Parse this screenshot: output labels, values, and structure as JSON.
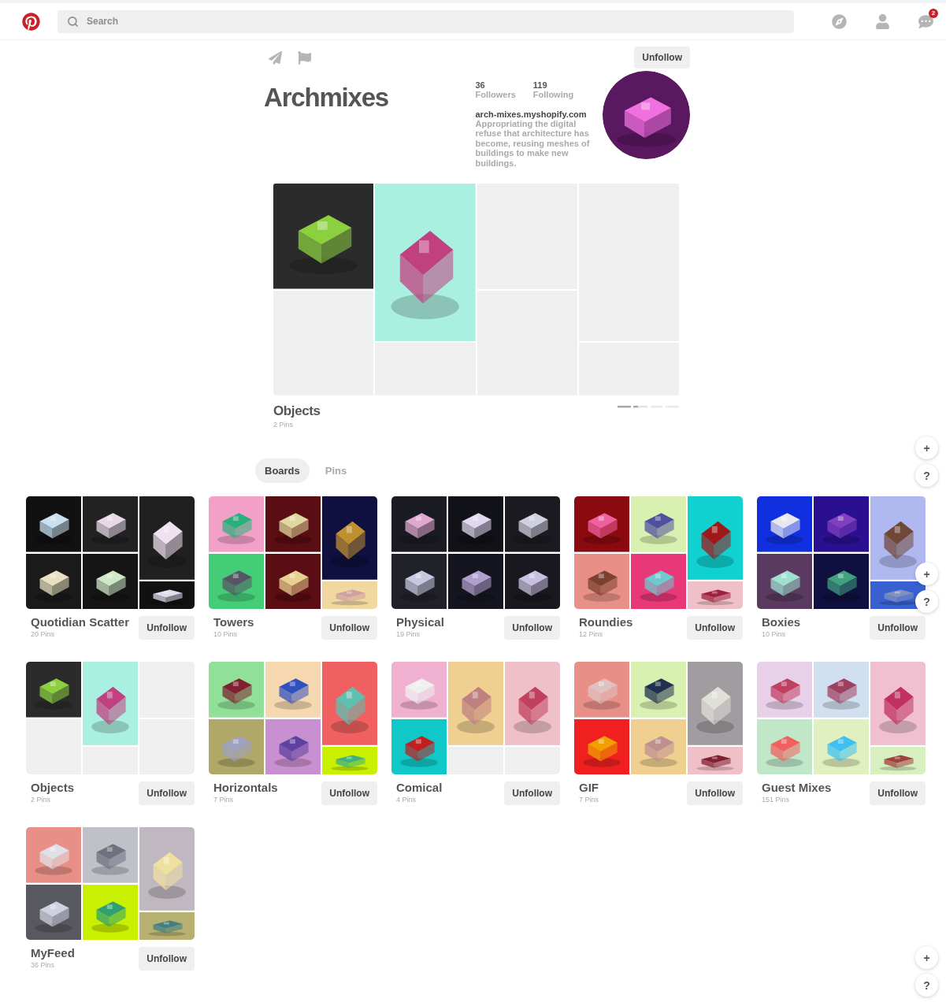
{
  "header": {
    "search": {
      "placeholder": "Search"
    },
    "notifications_badge": "2"
  },
  "profile": {
    "name": "Archmixes",
    "unfollow": "Unfollow",
    "followers": {
      "count": "36",
      "label": "Followers"
    },
    "following": {
      "count": "119",
      "label": "Following"
    },
    "website": "arch-mixes.myshopify.com",
    "bio": "Appropriating the digital refuse that architecture has become, reusing meshes of buildings to make new buildings."
  },
  "featured_board": {
    "title": "Objects",
    "pins": "2 Pins",
    "columns": [
      {
        "kind": "even",
        "tiles": [
          {
            "kind": "picture"
          },
          {
            "kind": "empty"
          }
        ]
      },
      {
        "kind": "tall",
        "tiles": [
          {
            "kind": "picture"
          },
          {
            "kind": "empty"
          }
        ]
      },
      {
        "kind": "even",
        "tiles": [
          {
            "kind": "empty"
          },
          {
            "kind": "empty"
          }
        ]
      },
      {
        "kind": "tall",
        "tiles": [
          {
            "kind": "empty"
          },
          {
            "kind": "empty"
          }
        ]
      }
    ]
  },
  "tabs": [
    {
      "label": "Boards",
      "selected": true
    },
    {
      "label": "Pins",
      "selected": false
    }
  ],
  "boards": [
    {
      "title": "Quotidian Scatter",
      "pins": "20 Pins",
      "button": "Unfollow",
      "columns": [
        {
          "kind": "even",
          "tiles": [
            {
              "kind": "picture"
            },
            {
              "kind": "picture"
            }
          ]
        },
        {
          "kind": "even",
          "tiles": [
            {
              "kind": "picture"
            },
            {
              "kind": "picture"
            }
          ]
        },
        {
          "kind": "tall",
          "tiles": [
            {
              "kind": "picture"
            },
            {
              "kind": "picture"
            }
          ]
        }
      ]
    },
    {
      "title": "Towers",
      "pins": "10 Pins",
      "button": "Unfollow",
      "columns": [
        {
          "kind": "even",
          "tiles": [
            {
              "kind": "picture"
            },
            {
              "kind": "picture"
            }
          ]
        },
        {
          "kind": "even",
          "tiles": [
            {
              "kind": "picture"
            },
            {
              "kind": "picture"
            }
          ]
        },
        {
          "kind": "tall",
          "tiles": [
            {
              "kind": "picture"
            },
            {
              "kind": "picture"
            }
          ]
        }
      ]
    },
    {
      "title": "Physical",
      "pins": "19 Pins",
      "button": "Unfollow",
      "columns": [
        {
          "kind": "even",
          "tiles": [
            {
              "kind": "picture"
            },
            {
              "kind": "picture"
            }
          ]
        },
        {
          "kind": "even",
          "tiles": [
            {
              "kind": "picture"
            },
            {
              "kind": "picture"
            }
          ]
        },
        {
          "kind": "even",
          "tiles": [
            {
              "kind": "picture"
            },
            {
              "kind": "picture"
            }
          ]
        }
      ]
    },
    {
      "title": "Roundies",
      "pins": "12 Pins",
      "button": "Unfollow",
      "columns": [
        {
          "kind": "even",
          "tiles": [
            {
              "kind": "picture"
            },
            {
              "kind": "picture"
            }
          ]
        },
        {
          "kind": "even",
          "tiles": [
            {
              "kind": "picture"
            },
            {
              "kind": "picture"
            }
          ]
        },
        {
          "kind": "tall",
          "tiles": [
            {
              "kind": "picture"
            },
            {
              "kind": "picture"
            }
          ]
        }
      ]
    },
    {
      "title": "Boxies",
      "pins": "10 Pins",
      "button": "Unfollow",
      "columns": [
        {
          "kind": "even",
          "tiles": [
            {
              "kind": "picture"
            },
            {
              "kind": "picture"
            }
          ]
        },
        {
          "kind": "even",
          "tiles": [
            {
              "kind": "picture"
            },
            {
              "kind": "picture"
            }
          ]
        },
        {
          "kind": "tall",
          "tiles": [
            {
              "kind": "picture"
            },
            {
              "kind": "picture"
            }
          ]
        }
      ]
    },
    {
      "title": "Objects",
      "pins": "2 Pins",
      "button": "Unfollow",
      "columns": [
        {
          "kind": "even",
          "tiles": [
            {
              "kind": "picture"
            },
            {
              "kind": "empty"
            }
          ]
        },
        {
          "kind": "tall",
          "tiles": [
            {
              "kind": "picture"
            },
            {
              "kind": "empty"
            }
          ]
        },
        {
          "kind": "even",
          "tiles": [
            {
              "kind": "empty"
            },
            {
              "kind": "empty"
            }
          ]
        }
      ]
    },
    {
      "title": "Horizontals",
      "pins": "7 Pins",
      "button": "Unfollow",
      "columns": [
        {
          "kind": "even",
          "tiles": [
            {
              "kind": "picture"
            },
            {
              "kind": "picture"
            }
          ]
        },
        {
          "kind": "even",
          "tiles": [
            {
              "kind": "picture"
            },
            {
              "kind": "picture"
            }
          ]
        },
        {
          "kind": "tall",
          "tiles": [
            {
              "kind": "picture"
            },
            {
              "kind": "picture"
            }
          ]
        }
      ]
    },
    {
      "title": "Comical",
      "pins": "4 Pins",
      "button": "Unfollow",
      "columns": [
        {
          "kind": "even",
          "tiles": [
            {
              "kind": "picture"
            },
            {
              "kind": "picture"
            }
          ]
        },
        {
          "kind": "tall",
          "tiles": [
            {
              "kind": "picture"
            },
            {
              "kind": "empty"
            }
          ]
        },
        {
          "kind": "tall",
          "tiles": [
            {
              "kind": "picture"
            },
            {
              "kind": "empty"
            }
          ]
        }
      ]
    },
    {
      "title": "GIF",
      "pins": "7 Pins",
      "button": "Unfollow",
      "columns": [
        {
          "kind": "even",
          "tiles": [
            {
              "kind": "picture"
            },
            {
              "kind": "picture"
            }
          ]
        },
        {
          "kind": "even",
          "tiles": [
            {
              "kind": "picture"
            },
            {
              "kind": "picture"
            }
          ]
        },
        {
          "kind": "tall",
          "tiles": [
            {
              "kind": "picture"
            },
            {
              "kind": "picture"
            }
          ]
        }
      ]
    },
    {
      "title": "Guest Mixes",
      "pins": "151 Pins",
      "button": "Unfollow",
      "columns": [
        {
          "kind": "even",
          "tiles": [
            {
              "kind": "picture"
            },
            {
              "kind": "picture"
            }
          ]
        },
        {
          "kind": "even",
          "tiles": [
            {
              "kind": "picture"
            },
            {
              "kind": "picture"
            }
          ]
        },
        {
          "kind": "tall",
          "tiles": [
            {
              "kind": "picture"
            },
            {
              "kind": "picture"
            }
          ]
        }
      ]
    },
    {
      "title": "MyFeed",
      "pins": "36 Pins",
      "button": "Unfollow",
      "columns": [
        {
          "kind": "even",
          "tiles": [
            {
              "kind": "picture"
            },
            {
              "kind": "picture"
            }
          ]
        },
        {
          "kind": "even",
          "tiles": [
            {
              "kind": "picture"
            },
            {
              "kind": "picture"
            }
          ]
        },
        {
          "kind": "tall",
          "tiles": [
            {
              "kind": "picture"
            },
            {
              "kind": "picture"
            }
          ]
        }
      ]
    }
  ],
  "floating_buttons": [
    {
      "add": "+",
      "help": "?"
    },
    {
      "add": "+",
      "help": "?"
    },
    {
      "add": "+",
      "help": "?"
    }
  ]
}
